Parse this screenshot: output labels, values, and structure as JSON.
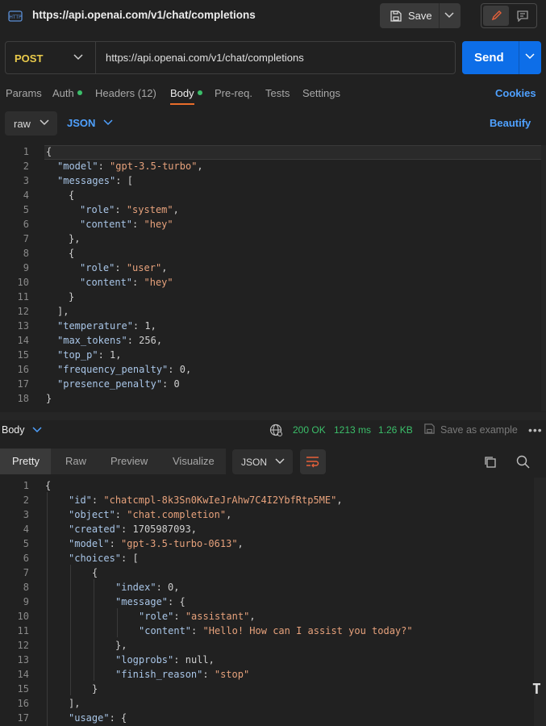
{
  "header": {
    "title": "https://api.openai.com/v1/chat/completions",
    "save_label": "Save"
  },
  "request": {
    "method": "POST",
    "url": "https://api.openai.com/v1/chat/completions",
    "send_label": "Send"
  },
  "tabs": [
    {
      "label": "Params"
    },
    {
      "label": "Auth"
    },
    {
      "label": "Headers (12)"
    },
    {
      "label": "Body"
    },
    {
      "label": "Pre-req."
    },
    {
      "label": "Tests"
    },
    {
      "label": "Settings"
    }
  ],
  "cookies_label": "Cookies",
  "body_options": {
    "mode": "raw",
    "language": "JSON",
    "beautify_label": "Beautify"
  },
  "request_body": [
    "{",
    "\"model\": \"gpt-3.5-turbo\",",
    "\"messages\": [",
    "{",
    "\"role\": \"system\",",
    "\"content\": \"hey\"",
    "},",
    "{",
    "\"role\": \"user\",",
    "\"content\": \"hey\"",
    "}",
    "],",
    "\"temperature\": 1,",
    "\"max_tokens\": 256,",
    "\"top_p\": 1,",
    "\"frequency_penalty\": 0,",
    "\"presence_penalty\": 0",
    "}"
  ],
  "response": {
    "section_label": "Body",
    "status": "200 OK",
    "time": "1213 ms",
    "size": "1.26 KB",
    "save_example_label": "Save as example",
    "more_label": "•••",
    "view_tabs": [
      "Pretty",
      "Raw",
      "Preview",
      "Visualize"
    ],
    "format": "JSON",
    "lines": [
      "{",
      "\"id\": \"chatcmpl-8k3Sn0KwIeJrAhw7C4I2YbfRtp5ME\",",
      "\"object\": \"chat.completion\",",
      "\"created\": 1705987093,",
      "\"model\": \"gpt-3.5-turbo-0613\",",
      "\"choices\": [",
      "{",
      "\"index\": 0,",
      "\"message\": {",
      "\"role\": \"assistant\",",
      "\"content\": \"Hello! How can I assist you today?\"",
      "},",
      "\"logprobs\": null,",
      "\"finish_reason\": \"stop\"",
      "}",
      "],",
      "\"usage\": {"
    ]
  },
  "colors": {
    "method": "#eacb4b",
    "accent_blue": "#0d6ee8",
    "link_blue": "#4fa1ff",
    "status_green": "#3bbf6a",
    "tab_underline": "#e96d2a",
    "json_key": "#a9c6e8",
    "json_string": "#e7a27c"
  },
  "icons": [
    "http-icon",
    "save-icon",
    "chevron-down-icon",
    "pencil-icon",
    "comment-icon",
    "globe-icon",
    "copy-icon",
    "search-icon",
    "wrap-lines-icon",
    "text-cursor-icon"
  ]
}
